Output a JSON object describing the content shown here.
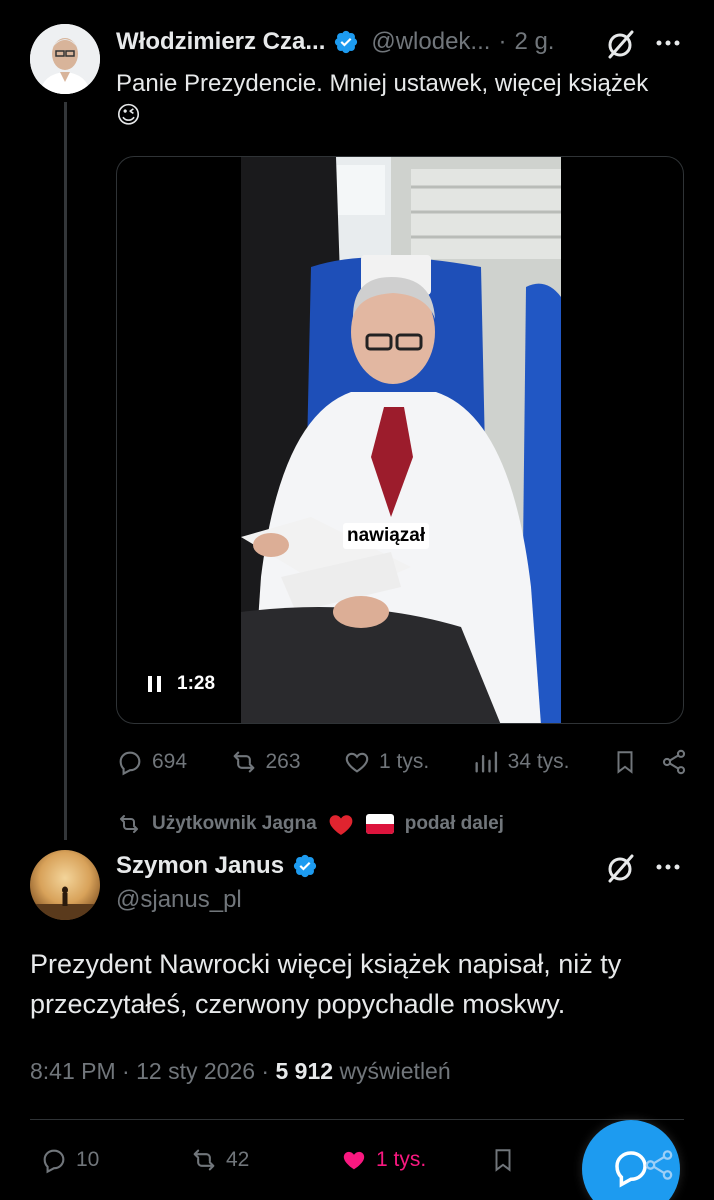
{
  "tweet1": {
    "author_name": "Włodzimierz Cza...",
    "handle": "@wlodek...",
    "separator": "·",
    "age": "2 g.",
    "text": "Panie Prezydencie. Mniej ustawek, więcej książek😉",
    "video": {
      "caption": "nawiązał",
      "duration": "1:28",
      "state_icon": "pause-icon"
    },
    "stats": {
      "replies": "694",
      "reposts": "263",
      "likes": "1 tys.",
      "views": "34 tys."
    }
  },
  "repost_banner": {
    "text_prefix": "Użytkownik Jagna",
    "text_suffix": "podał dalej"
  },
  "tweet2": {
    "author_name": "Szymon Janus",
    "handle": "@sjanus_pl",
    "text": "Prezydent Nawrocki więcej książek napisał, niż ty przeczytałeś, czerwony popychadle moskwy.",
    "time": "8:41 PM",
    "date": "12 sty 2026",
    "views_count": "5 912",
    "views_label": "wyświetleń",
    "stats": {
      "replies": "10",
      "reposts": "42",
      "likes": "1 tys."
    }
  },
  "colors": {
    "accent": "#1d9bf0",
    "like_active": "#f91880",
    "muted": "#71767b"
  }
}
